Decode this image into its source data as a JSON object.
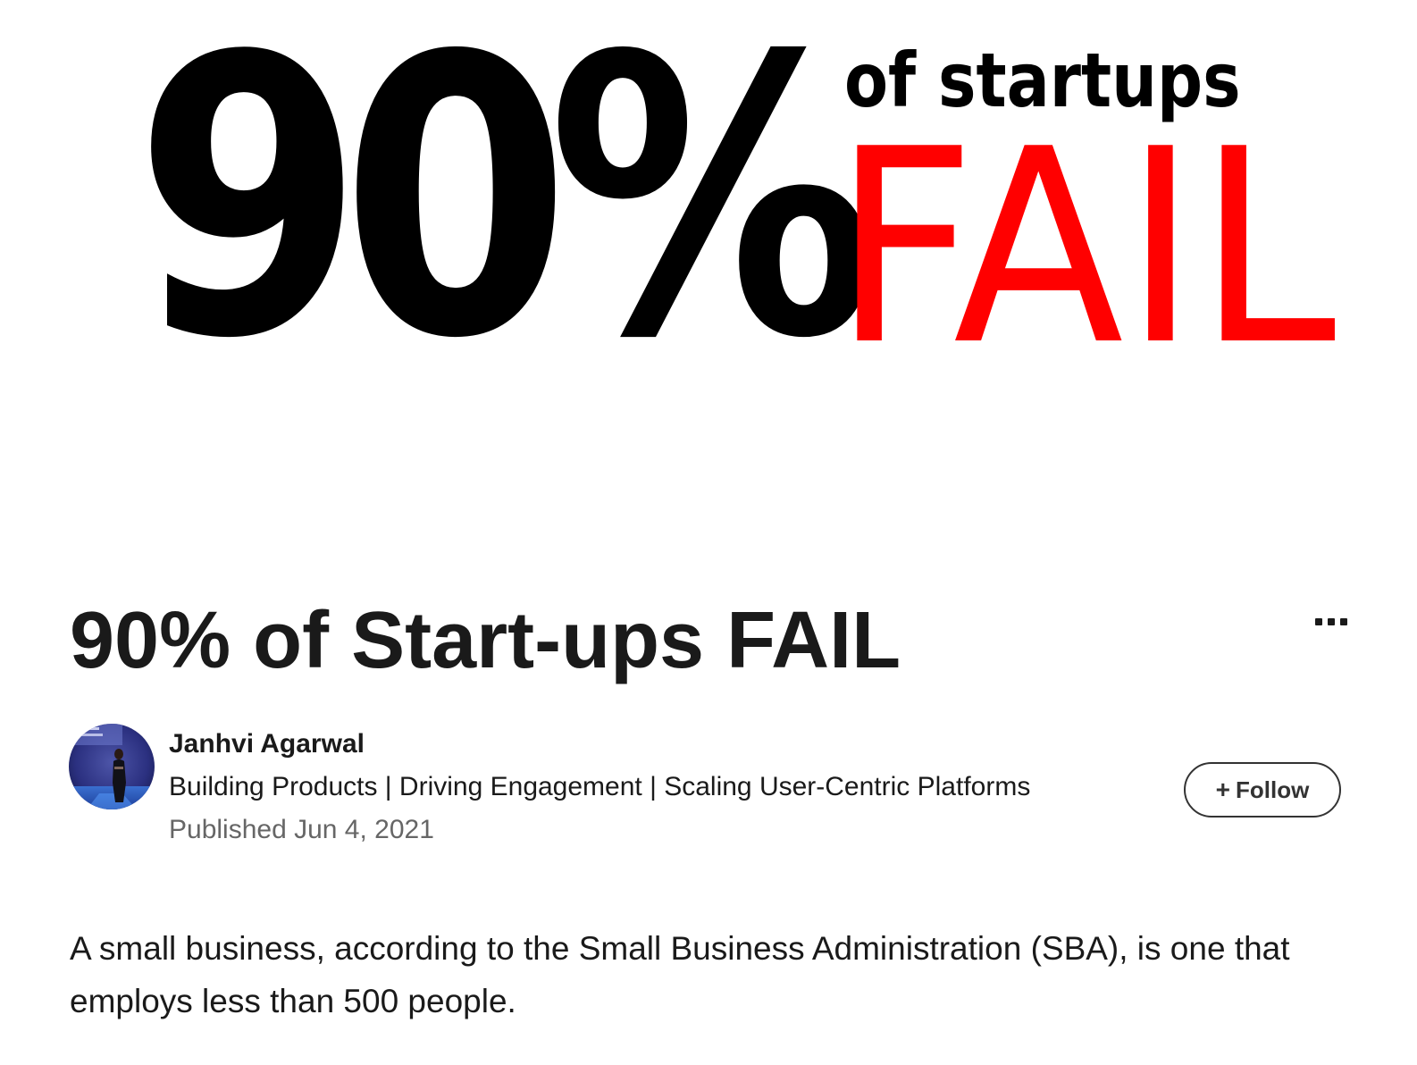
{
  "hero": {
    "percent": "90%",
    "subline": "of startups",
    "highlight": "FAIL",
    "highlight_color": "#ff0000"
  },
  "article": {
    "title": "90% of Start-ups FAIL",
    "more_icon": "more-horizontal-icon"
  },
  "author": {
    "name": "Janhvi Agarwal",
    "headline": "Building Products | Driving Engagement | Scaling User-Centric Platforms",
    "published": "Published Jun 4, 2021",
    "avatar_icon": "avatar-photo"
  },
  "follow": {
    "plus": "+",
    "label": "Follow"
  },
  "body": {
    "paragraph": "A small business, according to the Small Business Administration (SBA), is one that employs less than 500 people."
  }
}
